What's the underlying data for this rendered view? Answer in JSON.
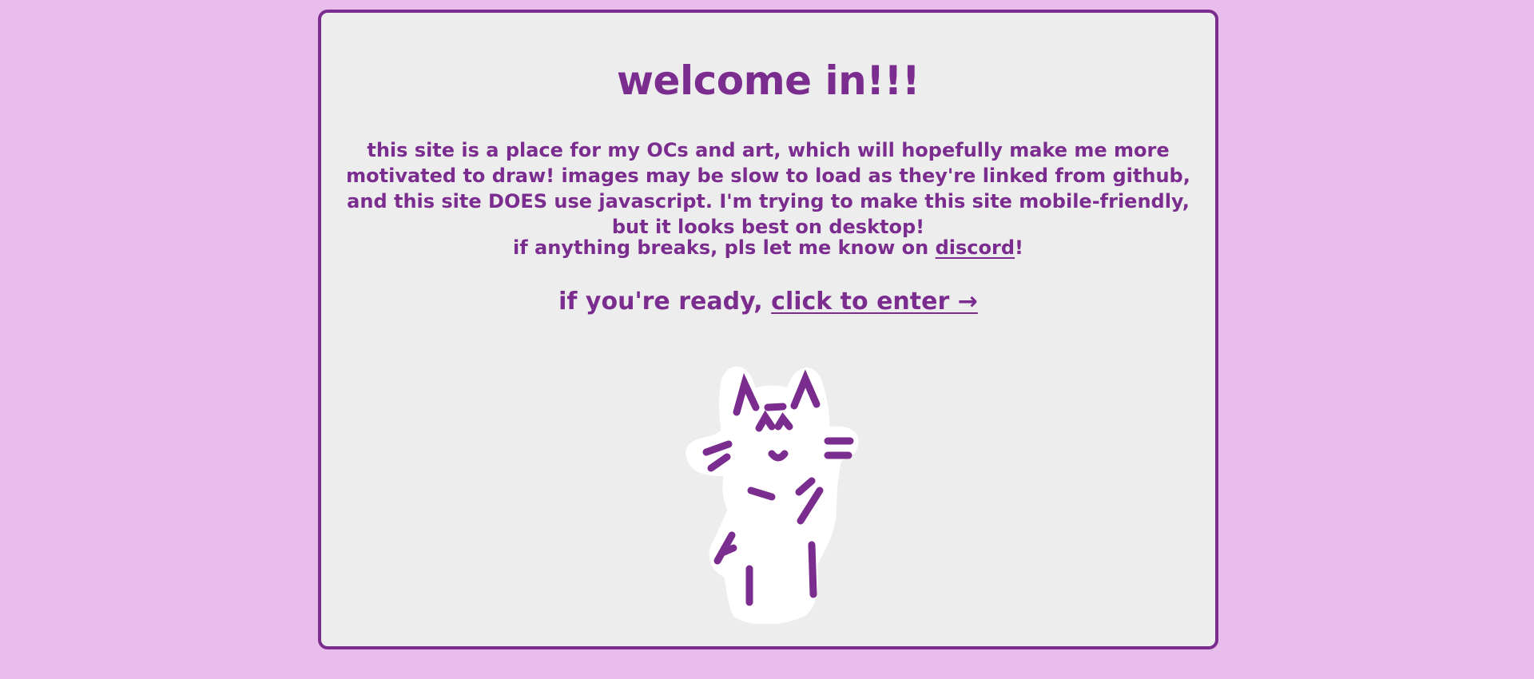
{
  "page": {
    "title": "welcome in!!!",
    "intro": "this site is a place for my OCs and art, which will hopefully make me more motivated to draw! images may be slow to load as they're linked from github, and this site DOES use javascript. I'm trying to make this site mobile-friendly, but it looks best on desktop!",
    "contact_prefix": "if anything breaks, pls let me know on ",
    "contact_link": "discord",
    "contact_suffix": "!",
    "enter_prefix": "if you're ready, ",
    "enter_link": "click to enter →"
  },
  "mascot": {
    "icon": "cat-mascot-icon"
  },
  "colors": {
    "background": "#e8bdec",
    "card": "#ededed",
    "accent": "#7b2d8f"
  }
}
